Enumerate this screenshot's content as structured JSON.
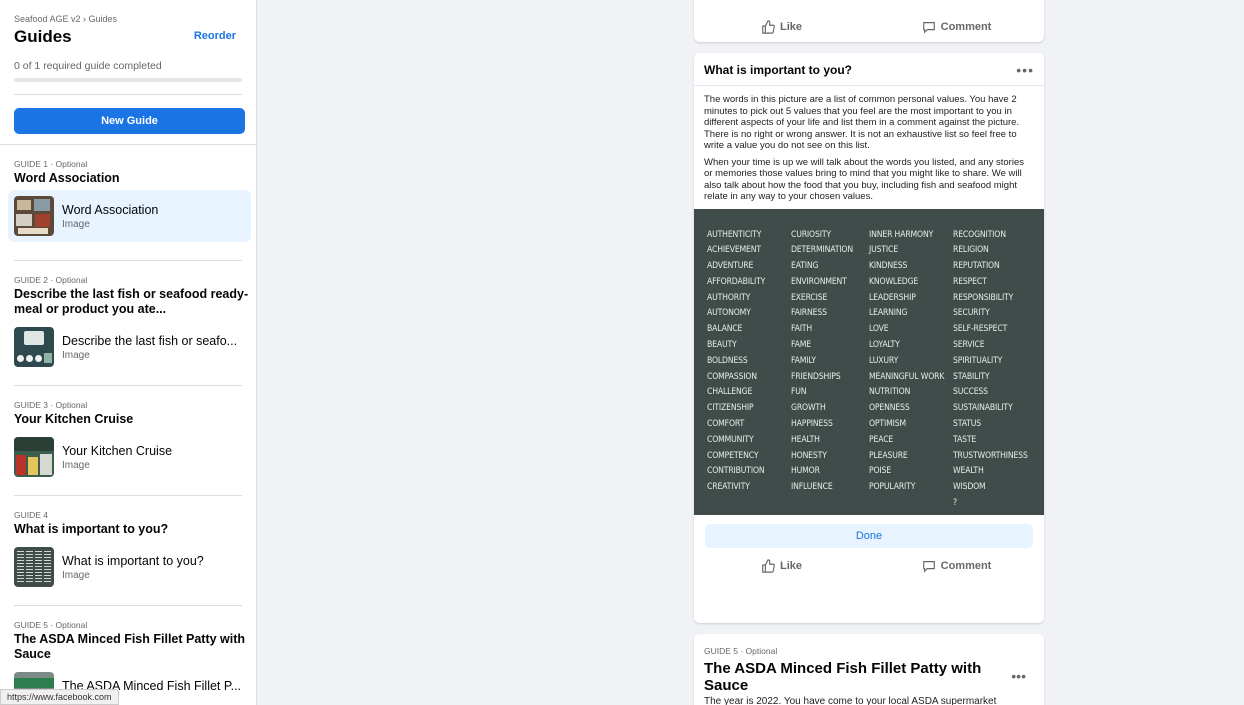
{
  "sidebar": {
    "breadcrumb": "Seafood AGE v2 › Guides",
    "title": "Guides",
    "reorder_label": "Reorder",
    "progress_text": "0 of 1 required guide completed",
    "progress_fraction": 0,
    "new_guide_label": "New Guide",
    "guides": [
      {
        "meta": "GUIDE 1 · Optional",
        "title": "Word Association",
        "item_title": "Word Association",
        "item_sub": "Image"
      },
      {
        "meta": "GUIDE 2 · Optional",
        "title": "Describe the last fish or seafood ready-meal or product you ate...",
        "item_title": "Describe the last fish or seafo...",
        "item_sub": "Image"
      },
      {
        "meta": "GUIDE 3 · Optional",
        "title": "Your Kitchen Cruise",
        "item_title": "Your Kitchen Cruise",
        "item_sub": "Image"
      },
      {
        "meta": "GUIDE 4",
        "title": "What is important to you?",
        "item_title": "What is important to you?",
        "item_sub": "Image"
      },
      {
        "meta": "GUIDE 5 · Optional",
        "title": "The ASDA Minced Fish Fillet Patty with Sauce",
        "item_title": "The ASDA Minced Fish Fillet P...",
        "item_sub": "Image"
      }
    ]
  },
  "status_url": "https://www.facebook.com",
  "feed": {
    "like_label": "Like",
    "comment_label": "Comment",
    "post": {
      "title": "What is important to you?",
      "more": "•••",
      "para1": "The words in this picture are a list of common personal values. You have 2 minutes to pick out 5 values that you feel are the most important to you in different aspects of your life and list them in a comment against the picture. There is no right or wrong answer. It is not an exhaustive list so feel free to write a value you do not see on this list.",
      "para2": "When your time is up we will talk about the words you listed, and any stories or memories those values bring to mind that you might like to share. We will also talk about how the food that you buy, including fish and seafood might relate in any way to your chosen values.",
      "values_columns": [
        [
          "AUTHENTICITY",
          "ACHIEVEMENT",
          "ADVENTURE",
          "AFFORDABILITY",
          "AUTHORITY",
          "AUTONOMY",
          "BALANCE",
          "BEAUTY",
          "BOLDNESS",
          "COMPASSION",
          "CHALLENGE",
          "CITIZENSHIP",
          "COMFORT",
          "COMMUNITY",
          "COMPETENCY",
          "CONTRIBUTION",
          "CREATIVITY"
        ],
        [
          "CURIOSITY",
          "DETERMINATION",
          "EATING",
          "ENVIRONMENT",
          "EXERCISE",
          "FAIRNESS",
          "FAITH",
          "FAME",
          "FAMILY",
          "FRIENDSHIPS",
          "FUN",
          "GROWTH",
          "HAPPINESS",
          "HEALTH",
          "HONESTY",
          "HUMOR",
          "INFLUENCE"
        ],
        [
          "INNER HARMONY",
          "JUSTICE",
          "KINDNESS",
          "KNOWLEDGE",
          "LEADERSHIP",
          "LEARNING",
          "LOVE",
          "LOYALTY",
          "LUXURY",
          "MEANINGFUL WORK",
          "NUTRITION",
          "OPENNESS",
          "OPTIMISM",
          "PEACE",
          "PLEASURE",
          "POISE",
          "POPULARITY"
        ],
        [
          "RECOGNITION",
          "RELIGION",
          "REPUTATION",
          "RESPECT",
          "RESPONSIBILITY",
          "SECURITY",
          "SELF-RESPECT",
          "SERVICE",
          "SPIRITUALITY",
          "STABILITY",
          "SUCCESS",
          "SUSTAINABILITY",
          "STATUS",
          "TASTE",
          "TRUSTWORTHINESS",
          "WEALTH",
          "WISDOM",
          "?"
        ]
      ],
      "done_label": "Done"
    },
    "next_post": {
      "meta": "GUIDE 5 · Optional",
      "title": "The ASDA Minced Fish Fillet Patty with Sauce",
      "more": "•••",
      "text": "The year is 2022. You have come to your local ASDA supermarket"
    }
  },
  "colors": {
    "accent": "#1b74e4",
    "values_bg": "#3f4c4a",
    "active_item": "#e7f3ff"
  }
}
